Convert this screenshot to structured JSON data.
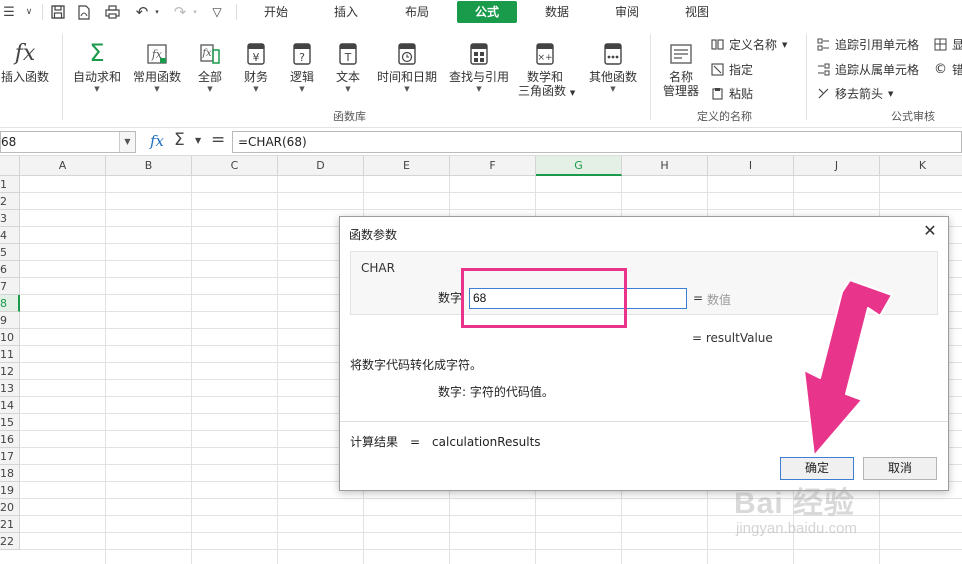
{
  "menubar": {
    "tabs": [
      "开始",
      "插入",
      "布局",
      "公式",
      "数据",
      "审阅",
      "视图"
    ],
    "active_tab": "公式",
    "accent_color": "#1a9a4b"
  },
  "ribbon": {
    "insert_function": "插入函数",
    "autosum": "自动求和",
    "common_functions": "常用函数",
    "all": "全部",
    "finance": "财务",
    "logic": "逻辑",
    "text": "文本",
    "datetime": "时间和日期",
    "lookup": "查找与引用",
    "math_line1": "数学和",
    "math_line2": "三角函数",
    "other": "其他函数",
    "group_library": "函数库",
    "name_manager_line1": "名称",
    "name_manager_line2": "管理器",
    "define_name": "定义名称",
    "assign": "指定",
    "paste": "粘贴",
    "group_names": "定义的名称",
    "trace_precedents": "追踪引用单元格",
    "trace_dependents": "追踪从属单元格",
    "remove_arrows": "移去箭头",
    "group_audit": "公式审核",
    "cut_show": "显",
    "cut_error": "错"
  },
  "formulabar": {
    "namebox": "68",
    "formula": "=CHAR(68)"
  },
  "grid": {
    "columns": [
      "A",
      "B",
      "C",
      "D",
      "E",
      "F",
      "G",
      "H",
      "I",
      "J",
      "K"
    ],
    "selected_column": "G",
    "rows": [
      "1",
      "2",
      "3",
      "4",
      "5",
      "6",
      "7",
      "8",
      "9",
      "10",
      "11",
      "12",
      "13",
      "14",
      "15",
      "16",
      "17",
      "18",
      "19",
      "20",
      "21",
      "22"
    ],
    "selected_row": "8"
  },
  "dialog": {
    "title": "函数参数",
    "function_name": "CHAR",
    "arg_label": "数字",
    "arg_value": "68",
    "arg_eq": "=",
    "arg_type": "数值",
    "result_eq": "= resultValue",
    "description": "将数字代码转化成字符。",
    "arg_description": "数字: 字符的代码值。",
    "calc_result": "计算结果　=　calculationResults",
    "ok": "确定",
    "cancel": "取消",
    "close_glyph": "✕"
  },
  "annotation": {
    "color": "#e8348b"
  },
  "watermark": {
    "brand": "Bai 经验",
    "url": "jingyan.baidu.com"
  }
}
